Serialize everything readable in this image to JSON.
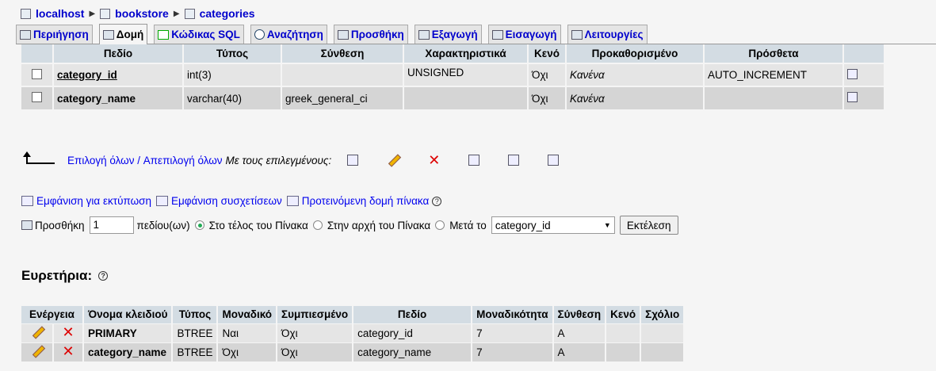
{
  "breadcrumb": {
    "server": "localhost",
    "database": "bookstore",
    "table": "categories"
  },
  "tabs": [
    {
      "label": "Περιήγηση",
      "icon": "browse-icon",
      "active": false
    },
    {
      "label": "Δομή",
      "icon": "structure-icon",
      "active": true
    },
    {
      "label": "Κώδικας SQL",
      "icon": "sql-icon",
      "active": false
    },
    {
      "label": "Αναζήτηση",
      "icon": "search-icon",
      "active": false
    },
    {
      "label": "Προσθήκη",
      "icon": "insert-icon",
      "active": false
    },
    {
      "label": "Εξαγωγή",
      "icon": "export-icon",
      "active": false
    },
    {
      "label": "Εισαγωγή",
      "icon": "import-icon",
      "active": false
    },
    {
      "label": "Λειτουργίες",
      "icon": "operations-icon",
      "active": false
    }
  ],
  "structure": {
    "headers": [
      "Πεδίο",
      "Τύπος",
      "Σύνθεση",
      "Χαρακτηριστικά",
      "Κενό",
      "Προκαθορισμένο",
      "Πρόσθετα"
    ],
    "rows": [
      {
        "field": "category_id",
        "type": "int(3)",
        "collation": "",
        "attributes": "UNSIGNED",
        "null": "Όχι",
        "default": "Κανένα",
        "extra": "AUTO_INCREMENT"
      },
      {
        "field": "category_name",
        "type": "varchar(40)",
        "collation": "greek_general_ci",
        "attributes": "",
        "null": "Όχι",
        "default": "Κανένα",
        "extra": ""
      }
    ]
  },
  "with_selected": {
    "check_all": "Επιλογή όλων",
    "separator": " / ",
    "uncheck_all": "Απεπιλογή όλων",
    "label": "Με τους επιλεγμένους:"
  },
  "links": {
    "print_view": "Εμφάνιση για εκτύπωση",
    "relation_view": "Εμφάνιση συσχετίσεων",
    "propose_structure": "Προτεινόμενη δομή πίνακα"
  },
  "add_fields": {
    "label": "Προσθήκη",
    "count": "1",
    "fields_label": "πεδίου(ων)",
    "at_end": "Στο τέλος του Πίνακα",
    "at_beginning": "Στην αρχή του Πίνακα",
    "after": "Μετά το",
    "after_field": "category_id",
    "go": "Εκτέλεση"
  },
  "indexes": {
    "title": "Ευρετήρια:",
    "headers": [
      "Ενέργεια",
      "Όνομα κλειδιού",
      "Τύπος",
      "Μοναδικό",
      "Συμπιεσμένο",
      "Πεδίο",
      "Μοναδικότητα",
      "Σύνθεση",
      "Κενό",
      "Σχόλιο"
    ],
    "rows": [
      {
        "key": "PRIMARY",
        "type": "BTREE",
        "unique": "Ναι",
        "packed": "Όχι",
        "field": "category_id",
        "cardinality": "7",
        "collation": "A",
        "null": "",
        "comment": ""
      },
      {
        "key": "category_name",
        "type": "BTREE",
        "unique": "Όχι",
        "packed": "Όχι",
        "field": "category_name",
        "cardinality": "7",
        "collation": "A",
        "null": "",
        "comment": ""
      }
    ]
  }
}
